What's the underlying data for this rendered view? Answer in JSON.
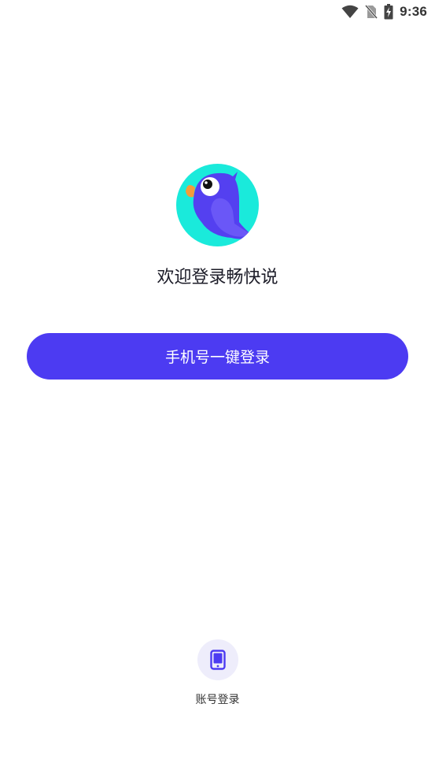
{
  "status_bar": {
    "time": "9:36",
    "icons": [
      "wifi-icon",
      "no-sim-icon",
      "battery-charging-icon"
    ]
  },
  "logo": {
    "icon": "parrot-logo-icon",
    "colors": {
      "background": "#1aeadb",
      "body": "#5440f0",
      "wing": "#6a57f7",
      "beak": "#f39c3a"
    }
  },
  "welcome_text": "欢迎登录畅快说",
  "primary_button": {
    "label": "手机号一键登录",
    "color": "#4c3bf2"
  },
  "account_login": {
    "icon": "phone-icon",
    "label": "账号登录",
    "accent": "#4c3bf2"
  }
}
